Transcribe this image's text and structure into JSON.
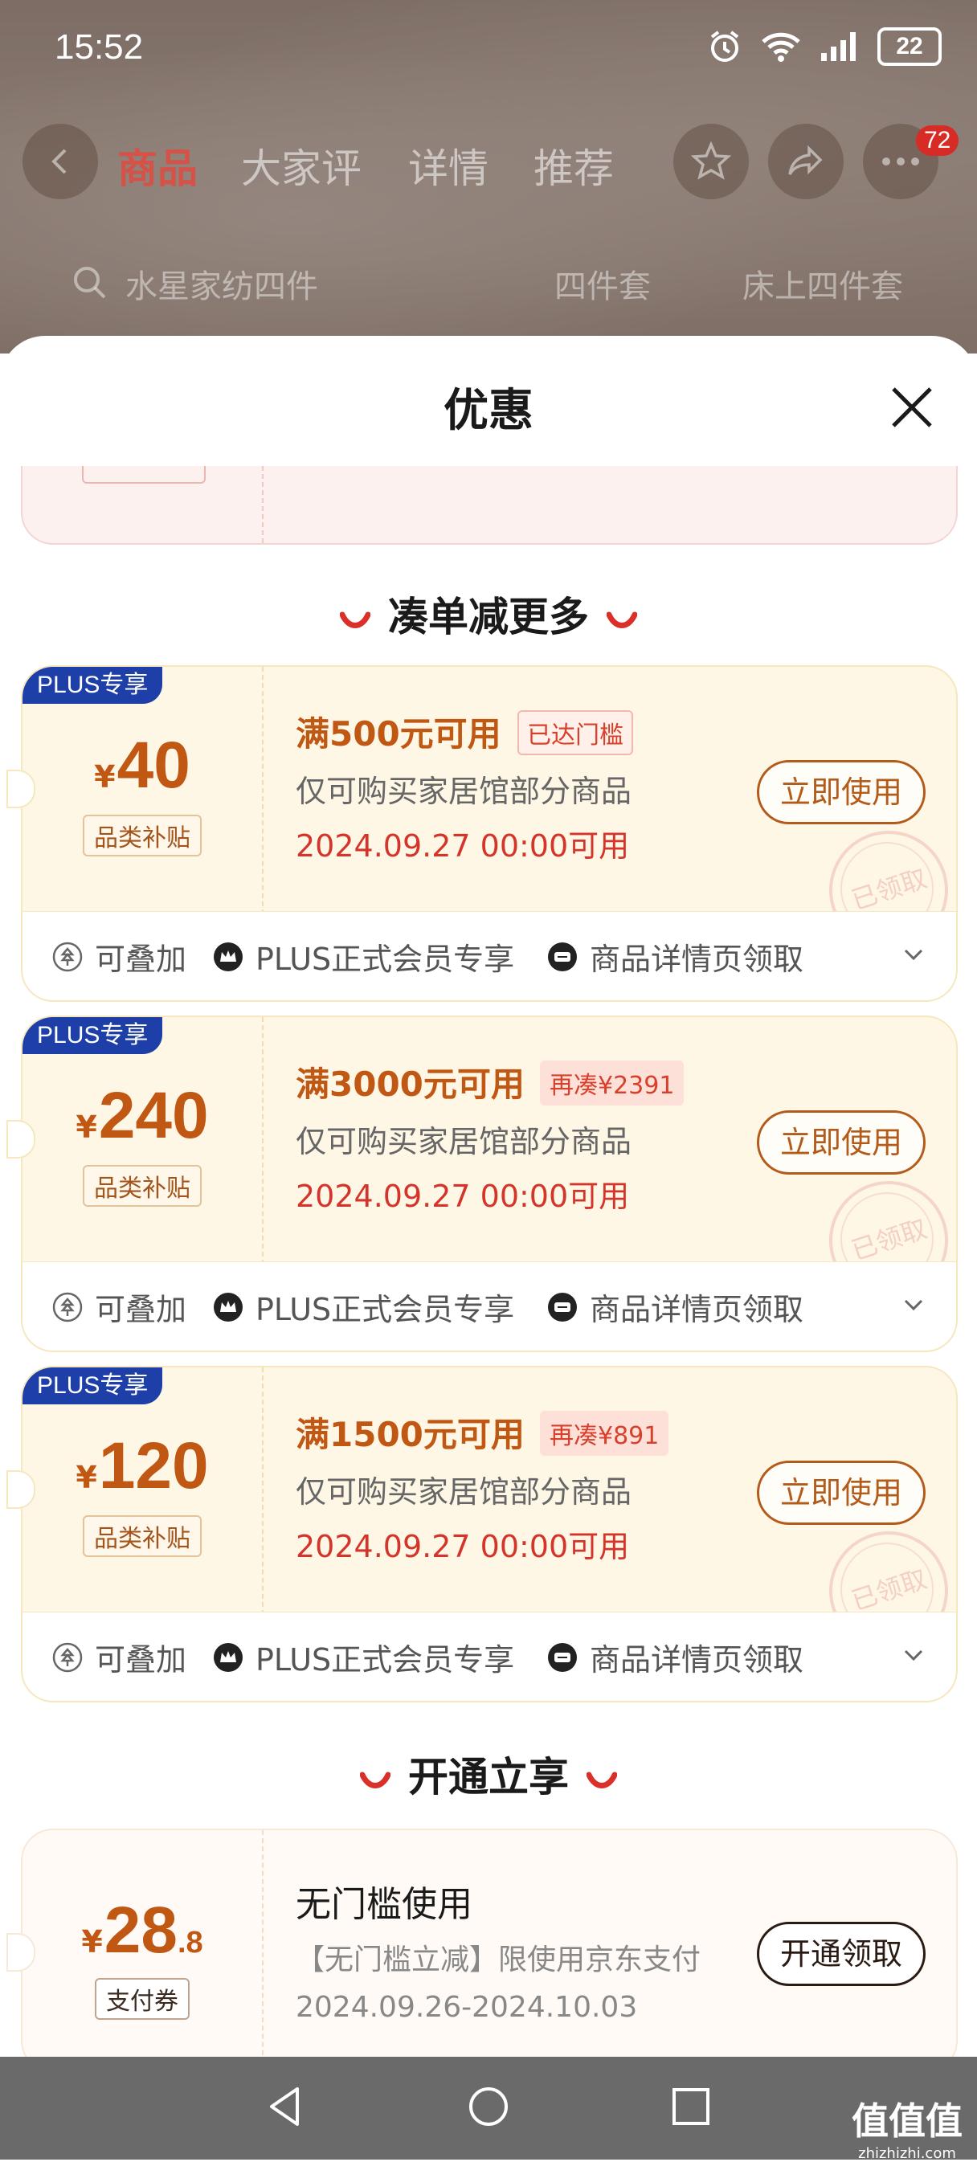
{
  "status_bar": {
    "time": "15:52",
    "battery": "22"
  },
  "background": {
    "tabs": [
      "商品",
      "大家评",
      "详情",
      "推荐"
    ],
    "badge": "72",
    "search": [
      "水星家纺四件",
      "四件套",
      "床上四件套"
    ]
  },
  "sheet": {
    "title": "优惠",
    "section1": "凑单减更多",
    "section2": "开通立享"
  },
  "coupons": [
    {
      "tag": "PLUS专享",
      "yen": "¥",
      "amount": "40",
      "category": "品类补贴",
      "condition": "满500元可用",
      "badge": "已达门槛",
      "badge_type": "reached",
      "desc": "仅可购买家居馆部分商品",
      "date": "2024.09.27 00:00可用",
      "button": "立即使用",
      "stamp": "已领取",
      "foot": [
        "可叠加",
        "PLUS正式会员专享",
        "商品详情页领取"
      ]
    },
    {
      "tag": "PLUS专享",
      "yen": "¥",
      "amount": "240",
      "category": "品类补贴",
      "condition": "满3000元可用",
      "badge": "再凑¥2391",
      "badge_type": "more",
      "desc": "仅可购买家居馆部分商品",
      "date": "2024.09.27 00:00可用",
      "button": "立即使用",
      "stamp": "已领取",
      "foot": [
        "可叠加",
        "PLUS正式会员专享",
        "商品详情页领取"
      ]
    },
    {
      "tag": "PLUS专享",
      "yen": "¥",
      "amount": "120",
      "category": "品类补贴",
      "condition": "满1500元可用",
      "badge": "再凑¥891",
      "badge_type": "more",
      "desc": "仅可购买家居馆部分商品",
      "date": "2024.09.27 00:00可用",
      "button": "立即使用",
      "stamp": "已领取",
      "foot": [
        "可叠加",
        "PLUS正式会员专享",
        "商品详情页领取"
      ]
    }
  ],
  "pay_coupon": {
    "yen": "¥",
    "amount": "28",
    "decimal": ".8",
    "category": "支付券",
    "title": "无门槛使用",
    "desc": "【无门槛立减】限使用京东支付",
    "date": "2024.09.26-2024.10.03",
    "button": "开通领取"
  },
  "watermark": {
    "text": "值值值",
    "url": "zhizhizhi.com"
  },
  "colors": {
    "accent": "#c05713",
    "red": "#d4352b",
    "plus_blue": "#1f3fa8"
  }
}
